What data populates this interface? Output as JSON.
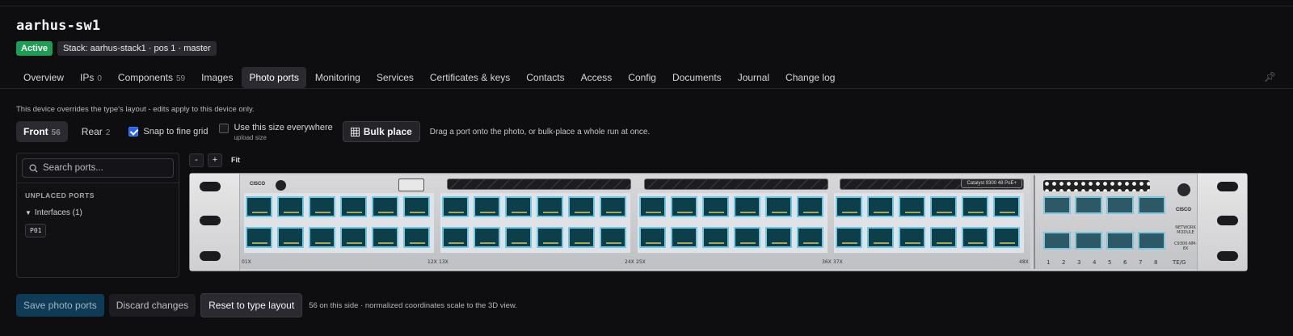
{
  "device": {
    "title": "aarhus-sw1",
    "status": "Active",
    "stack": "Stack: aarhus-stack1 · pos 1 · master"
  },
  "tabs": [
    {
      "label": "Overview",
      "count": ""
    },
    {
      "label": "IPs",
      "count": "0"
    },
    {
      "label": "Components",
      "count": "59"
    },
    {
      "label": "Images",
      "count": ""
    },
    {
      "label": "Photo ports",
      "count": "",
      "active": true
    },
    {
      "label": "Monitoring",
      "count": ""
    },
    {
      "label": "Services",
      "count": ""
    },
    {
      "label": "Certificates & keys",
      "count": ""
    },
    {
      "label": "Contacts",
      "count": ""
    },
    {
      "label": "Access",
      "count": ""
    },
    {
      "label": "Config",
      "count": ""
    },
    {
      "label": "Documents",
      "count": ""
    },
    {
      "label": "Journal",
      "count": ""
    },
    {
      "label": "Change log",
      "count": ""
    }
  ],
  "note": "This device overrides the type's layout - edits apply to this device only.",
  "sides": {
    "front_label": "Front",
    "front_count": "56",
    "rear_label": "Rear",
    "rear_count": "2"
  },
  "options": {
    "snap_label": "Snap to fine grid",
    "snap_checked": true,
    "use_size_label": "Use this size everywhere",
    "use_size_sub": "upload size",
    "use_size_checked": false
  },
  "bulk_label": "Bulk place",
  "hint": "Drag a port onto the photo, or bulk-place a whole run at once.",
  "sidebar": {
    "search_placeholder": "Search ports...",
    "unplaced_title": "UNPLACED PORTS",
    "group_label": "Interfaces (1)",
    "port_chip": "P01"
  },
  "zoom": {
    "minus": "-",
    "plus": "+",
    "fit": "Fit"
  },
  "photo": {
    "model_badge": "Catalyst 9300 48 PoE+",
    "range_labels": [
      "01X",
      "12X",
      "13X",
      "24X",
      "25X",
      "36X",
      "37X",
      "48X"
    ],
    "module_text_1": "NETWORK MODULE",
    "module_text_2": "C9300-NM-8X",
    "module_ports": [
      "1",
      "2",
      "3",
      "4",
      "5",
      "6",
      "7",
      "8"
    ],
    "module_tag": "TE/G",
    "brand": "CISCO"
  },
  "footer": {
    "save": "Save photo ports",
    "discard": "Discard changes",
    "reset": "Reset to type layout",
    "note": "56 on this side · normalized coordinates scale to the 3D view."
  }
}
